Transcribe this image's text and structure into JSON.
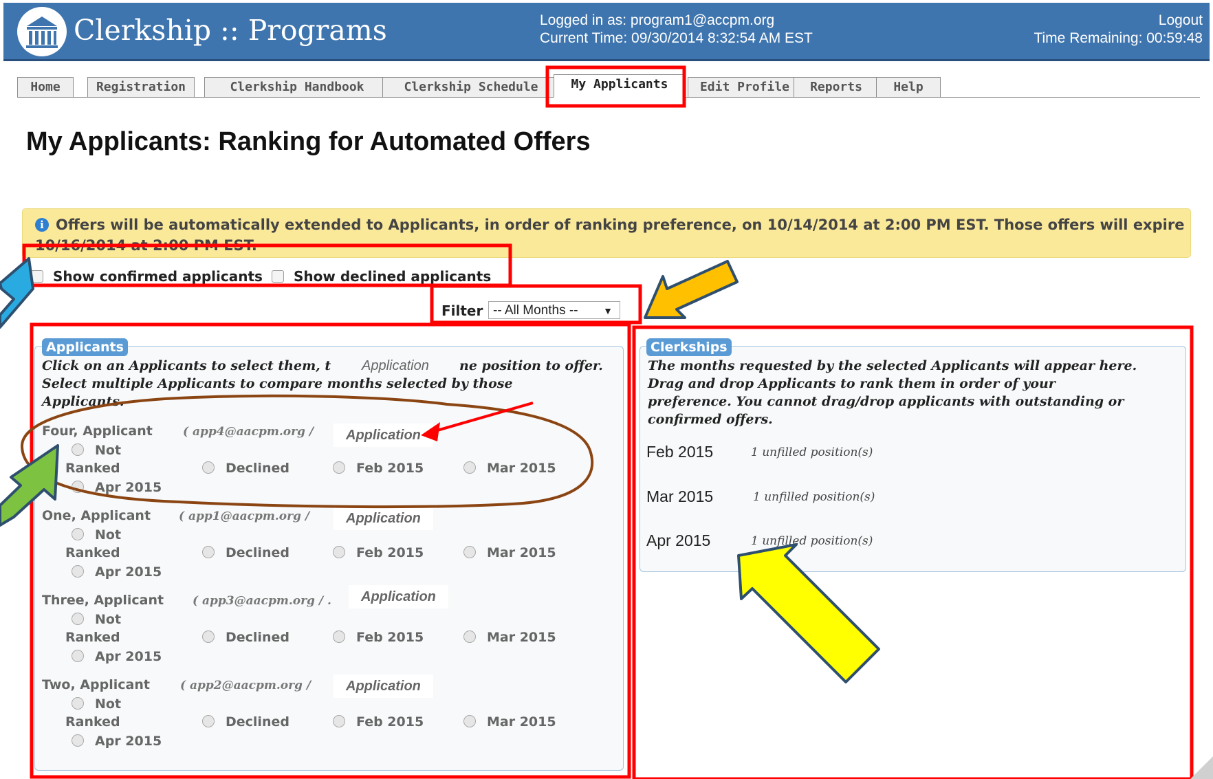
{
  "header": {
    "app_title": "Clerkship :: Programs",
    "logged_in": "Logged in as: program1@accpm.org",
    "current_time": "Current Time: 09/30/2014 8:32:54 AM EST",
    "logout": "Logout",
    "time_remaining": "Time Remaining: 00:59:48"
  },
  "tabs": [
    "Home",
    "Registration",
    "Clerkship Handbook",
    "Clerkship Schedule",
    "My Applicants",
    "Edit Profile",
    "Reports",
    "Help"
  ],
  "active_tab": "My Applicants",
  "page_title": "My Applicants: Ranking for Automated Offers",
  "notice": {
    "text": "Offers will be automatically extended to Applicants, in order of ranking preference, on 10/14/2014 at 2:00 PM EST. Those offers will expire 10/16/2014 at 2:00 PM EST."
  },
  "options": {
    "show_confirmed": "Show confirmed applicants",
    "show_declined": "Show declined applicants"
  },
  "filter": {
    "label": "Filter",
    "selected": "-- All Months --"
  },
  "applicants_panel": {
    "legend": "Applicants",
    "instruction_line1": "Click on an Applicants to select them, t",
    "instruction_line1_end": "ne position to offer.",
    "instruction_line2": "Select multiple Applicants to compare months selected by those",
    "instruction_line3": "Applicants.",
    "overlay_application": "Application",
    "applicants": [
      {
        "name": "Four, Applicant",
        "email": "( app4@aacpm.org /",
        "application": "Application",
        "not_ranked_1": "Not",
        "not_ranked_2": "Ranked",
        "declined": "Declined",
        "feb": "Feb 2015",
        "mar": "Mar 2015",
        "apr": "Apr 2015"
      },
      {
        "name": "One, Applicant",
        "email": "( app1@aacpm.org /",
        "application": "Application",
        "not_ranked_1": "Not",
        "not_ranked_2": "Ranked",
        "declined": "Declined",
        "feb": "Feb 2015",
        "mar": "Mar 2015",
        "apr": "Apr 2015"
      },
      {
        "name": "Three, Applicant",
        "email": "( app3@aacpm.org / .",
        "application": "Application",
        "not_ranked_1": "Not",
        "not_ranked_2": "Ranked",
        "declined": "Declined",
        "feb": "Feb 2015",
        "mar": "Mar 2015",
        "apr": "Apr 2015"
      },
      {
        "name": "Two, Applicant",
        "email": "( app2@aacpm.org /",
        "application": "Application",
        "not_ranked_1": "Not",
        "not_ranked_2": "Ranked",
        "declined": "Declined",
        "feb": "Feb 2015",
        "mar": "Mar 2015",
        "apr": "Apr 2015"
      }
    ]
  },
  "clerkships_panel": {
    "legend": "Clerkships",
    "instructions": [
      "The months requested by the selected Applicants will appear here.",
      "Drag and drop Applicants to rank them in order of your",
      "preference. You cannot drag/drop applicants with outstanding or",
      "confirmed offers."
    ],
    "months": [
      {
        "month": "Feb 2015",
        "status": "1 unfilled position(s)"
      },
      {
        "month": "Mar 2015",
        "status": "1 unfilled position(s)"
      },
      {
        "month": "Apr 2015",
        "status": "1 unfilled position(s)"
      }
    ]
  },
  "colors": {
    "header_bg": "#3f75ae",
    "notice_bg": "#fbe99a",
    "legend_bg": "#5b9bd5",
    "annotation_red": "#ff0000",
    "annotation_brown": "#8b4513",
    "arrow_blue": "#29abe2",
    "arrow_orange": "#ffc000",
    "arrow_green": "#7dc241",
    "arrow_yellow": "#ffff00"
  }
}
